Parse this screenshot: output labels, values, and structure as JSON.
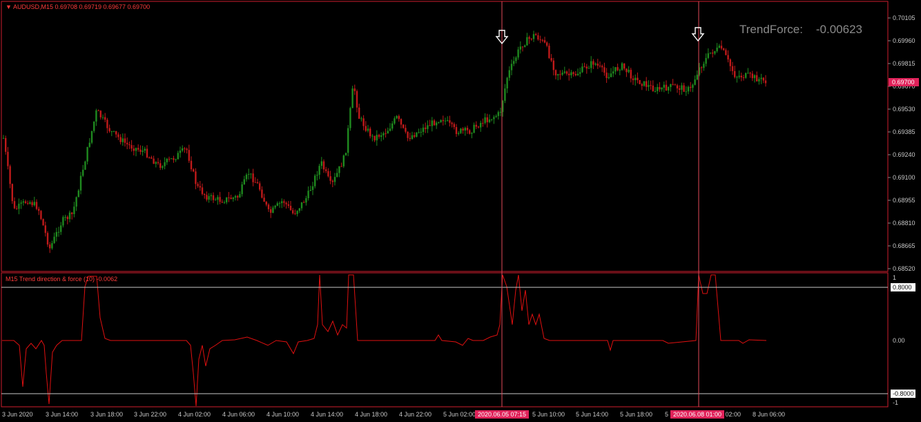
{
  "header": {
    "symbol_line": "AUDUSD,M15  0.69708 0.69719 0.69677 0.69700",
    "indicator_line": "M15 Trend direction & force (10) -0.0062"
  },
  "trendforce": {
    "label": "TrendForce:",
    "value": "-0.00623"
  },
  "colors": {
    "background": "#000000",
    "frame": "#d01e2e",
    "bull_candle": "#1f8a1f",
    "bear_candle": "#c01a1a",
    "indicator_line": "#e01010",
    "level_line": "#c8c8c8",
    "price_tag_bg": "#e0225a",
    "time_tag_bg": "#e0225a"
  },
  "price_axis": {
    "ticks": [
      "0.70105",
      "0.69960",
      "0.69815",
      "0.69670",
      "0.69530",
      "0.69385",
      "0.69240",
      "0.69100",
      "0.68955",
      "0.68810",
      "0.68665",
      "0.68520"
    ],
    "current_price": "0.69700"
  },
  "indicator_axis": {
    "ticks": [
      "1",
      "0.8000",
      "0.00",
      "-0.8000",
      "-1"
    ],
    "levels": [
      0.8,
      -0.8
    ]
  },
  "time_axis": {
    "labels": [
      "3 Jun 2020",
      "3 Jun 14:00",
      "3 Jun 18:00",
      "3 Jun 22:00",
      "4 Jun 02:00",
      "4 Jun 06:00",
      "4 Jun 10:00",
      "4 Jun 14:00",
      "4 Jun 18:00",
      "4 Jun 22:00",
      "5 Jun 02:00",
      "5 Jun 10:00",
      "5 Jun 14:00",
      "5 Jun 18:00",
      "5",
      "8 Jun 02:00",
      "8 Jun 06:00"
    ],
    "highlight_1": "2020.06.05 07:15",
    "highlight_2": "2020.06.08 01:00"
  },
  "chart_data": {
    "type": "line",
    "title": "AUDUSD,M15",
    "ohlc_last": {
      "open": 0.69708,
      "high": 0.69719,
      "low": 0.69677,
      "close": 0.697
    },
    "price_ylim": [
      0.6852,
      0.70105
    ],
    "indicator": {
      "name": "M15 Trend direction & force (10)",
      "last_value": -0.0062,
      "ylim": [
        -1,
        1
      ],
      "levels": [
        0.8,
        -0.8
      ]
    },
    "markers": [
      {
        "time": "2020.06.05 07:15",
        "type": "down-arrow"
      },
      {
        "time": "2020.06.08 01:00",
        "type": "down-arrow"
      }
    ]
  }
}
